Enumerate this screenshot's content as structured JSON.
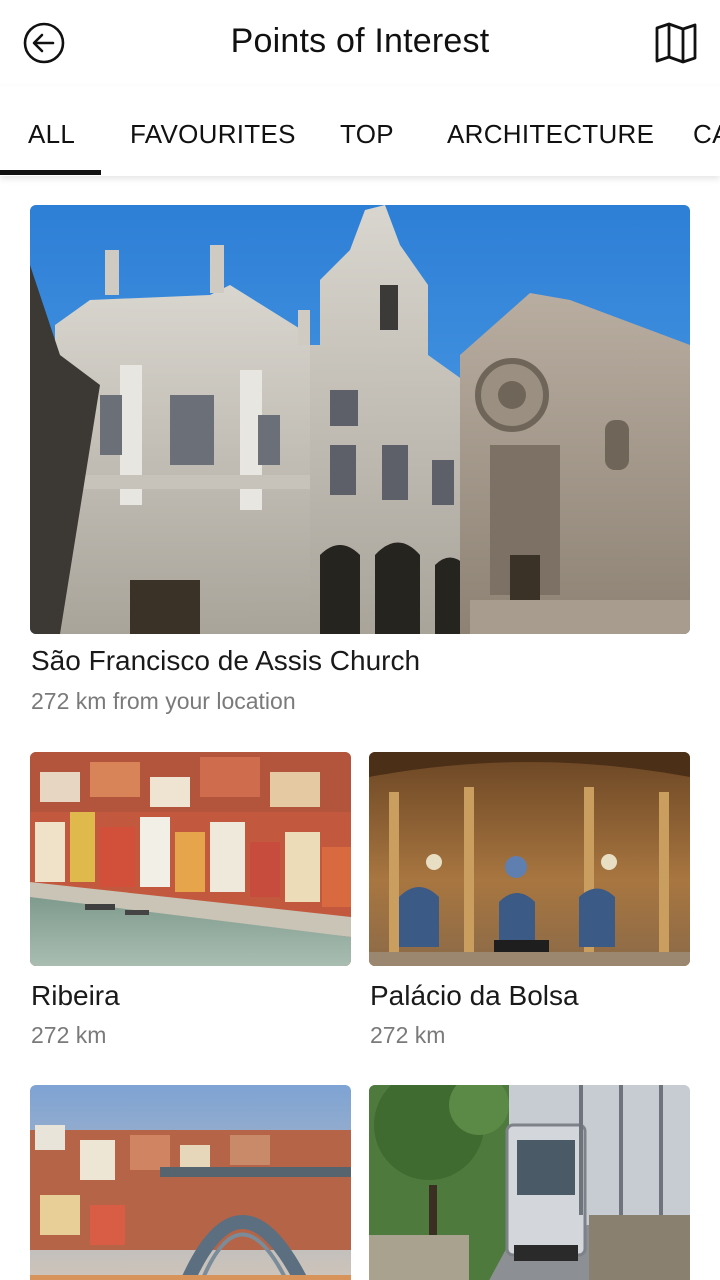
{
  "header": {
    "title": "Points of Interest",
    "back_icon": "back-arrow-icon",
    "map_icon": "map-icon"
  },
  "tabs": [
    {
      "label": "ALL",
      "active": true
    },
    {
      "label": "FAVOURITES",
      "active": false
    },
    {
      "label": "TOP",
      "active": false
    },
    {
      "label": "ARCHITECTURE",
      "active": false
    },
    {
      "label": "CA",
      "active": false
    }
  ],
  "places": [
    {
      "name": "São Francisco de Assis Church",
      "distance": "272 km from your location"
    },
    {
      "name": "Ribeira",
      "distance": "272 km"
    },
    {
      "name": "Palácio da Bolsa",
      "distance": "272 km"
    },
    {
      "name": "",
      "distance": ""
    },
    {
      "name": "",
      "distance": ""
    }
  ]
}
